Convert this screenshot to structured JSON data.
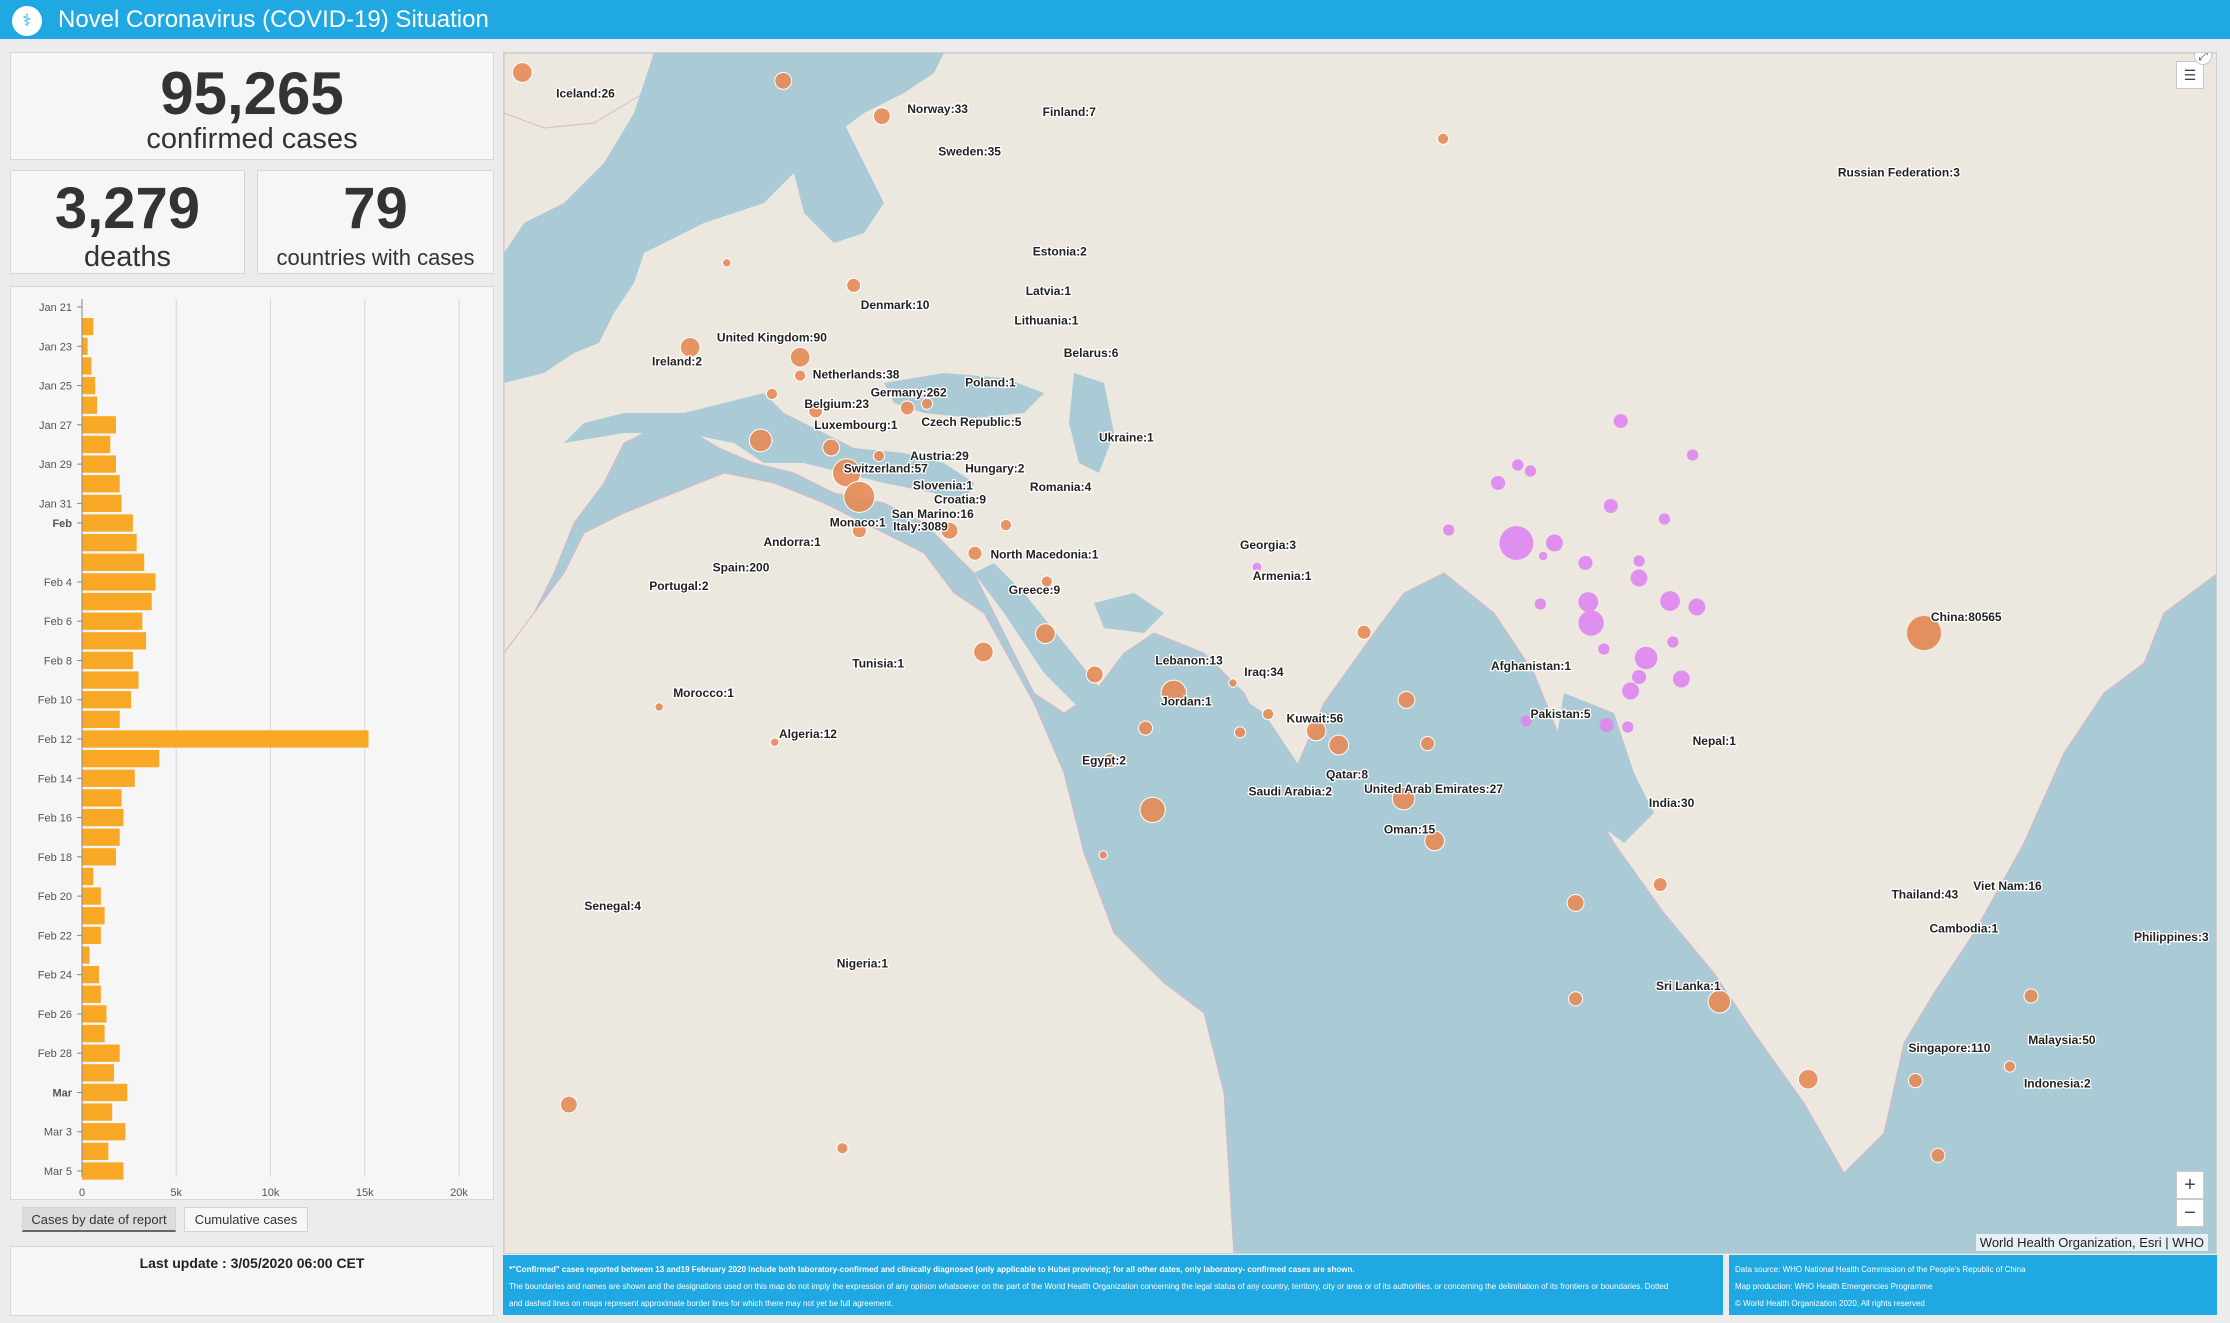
{
  "header": {
    "title": "Novel Coronavirus (COVID-19) Situation",
    "logo_icon": "who-emblem-icon"
  },
  "stats": {
    "confirmed_value": "95,265",
    "confirmed_label": "confirmed cases",
    "deaths_value": "3,279",
    "deaths_label": "deaths",
    "countries_value": "79",
    "countries_label": "countries with cases"
  },
  "chart_data": {
    "type": "bar",
    "orientation": "horizontal",
    "title": "",
    "xlabel": "",
    "ylabel": "",
    "xlim": [
      0,
      20000
    ],
    "x_ticks": [
      "0",
      "5k",
      "10k",
      "15k",
      "20k"
    ],
    "y_tick_labels": [
      "Jan 21",
      "Jan 23",
      "Jan 25",
      "Jan 27",
      "Jan 29",
      "Jan 31",
      "Feb",
      "Feb 4",
      "Feb 6",
      "Feb 8",
      "Feb 10",
      "Feb 12",
      "Feb 14",
      "Feb 16",
      "Feb 18",
      "Feb 20",
      "Feb 22",
      "Feb 24",
      "Feb 26",
      "Feb 28",
      "Mar",
      "Mar 3",
      "Mar 5"
    ],
    "bold_ticks": [
      "Feb",
      "Mar"
    ],
    "categories": [
      "Jan 21",
      "Jan 22",
      "Jan 23",
      "Jan 24",
      "Jan 25",
      "Jan 26",
      "Jan 27",
      "Jan 28",
      "Jan 29",
      "Jan 30",
      "Jan 31",
      "Feb 1",
      "Feb 2",
      "Feb 3",
      "Feb 4",
      "Feb 5",
      "Feb 6",
      "Feb 7",
      "Feb 8",
      "Feb 9",
      "Feb 10",
      "Feb 11",
      "Feb 12",
      "Feb 13",
      "Feb 14",
      "Feb 15",
      "Feb 16",
      "Feb 17",
      "Feb 18",
      "Feb 19",
      "Feb 20",
      "Feb 21",
      "Feb 22",
      "Feb 23",
      "Feb 24",
      "Feb 25",
      "Feb 26",
      "Feb 27",
      "Feb 28",
      "Feb 29",
      "Mar 1",
      "Mar 2",
      "Mar 3",
      "Mar 4",
      "Mar 5"
    ],
    "values": [
      0,
      600,
      300,
      500,
      700,
      800,
      1800,
      1500,
      1800,
      2000,
      2100,
      2700,
      2900,
      3300,
      3900,
      3700,
      3200,
      3400,
      2700,
      3000,
      2600,
      2000,
      15200,
      4100,
      2800,
      2100,
      2200,
      2000,
      1800,
      600,
      1000,
      1200,
      1000,
      400,
      900,
      1000,
      1300,
      1200,
      2000,
      1700,
      2400,
      1600,
      2300,
      1400,
      2200
    ],
    "color": "#f9a825",
    "grid": true
  },
  "tabs": [
    "Cases by date of report",
    "Cumulative cases"
  ],
  "last_update": "Last update : 3/05/2020 06:00 CET",
  "map": {
    "china_color": "#dd86f0",
    "country_color": "#e48b56",
    "labels": [
      {
        "text": "Iceland:26",
        "x": 37,
        "y": 26
      },
      {
        "text": "Norway:33",
        "x": 286,
        "y": 37
      },
      {
        "text": "Finland:7",
        "x": 382,
        "y": 39
      },
      {
        "text": "Sweden:35",
        "x": 308,
        "y": 67
      },
      {
        "text": "Russian Federation:3",
        "x": 946,
        "y": 82
      },
      {
        "text": "Estonia:2",
        "x": 375,
        "y": 138
      },
      {
        "text": "Latvia:1",
        "x": 370,
        "y": 166
      },
      {
        "text": "Denmark:10",
        "x": 253,
        "y": 176
      },
      {
        "text": "Lithuania:1",
        "x": 362,
        "y": 187
      },
      {
        "text": "United Kingdom:90",
        "x": 151,
        "y": 199
      },
      {
        "text": "Belarus:6",
        "x": 397,
        "y": 210
      },
      {
        "text": "Ireland:2",
        "x": 105,
        "y": 216
      },
      {
        "text": "Netherlands:38",
        "x": 219,
        "y": 225
      },
      {
        "text": "Poland:1",
        "x": 327,
        "y": 231
      },
      {
        "text": "Germany:262",
        "x": 260,
        "y": 238
      },
      {
        "text": "Belgium:23",
        "x": 213,
        "y": 246
      },
      {
        "text": "Luxembourg:1",
        "x": 220,
        "y": 261
      },
      {
        "text": "Czech Republic:5",
        "x": 296,
        "y": 259
      },
      {
        "text": "Ukraine:1",
        "x": 422,
        "y": 270
      },
      {
        "text": "Austria:29",
        "x": 288,
        "y": 283
      },
      {
        "text": "Switzerland:57",
        "x": 241,
        "y": 292
      },
      {
        "text": "Hungary:2",
        "x": 327,
        "y": 292
      },
      {
        "text": "Slovenia:1",
        "x": 290,
        "y": 304
      },
      {
        "text": "Romania:4",
        "x": 373,
        "y": 305
      },
      {
        "text": "Croatia:9",
        "x": 305,
        "y": 314
      },
      {
        "text": "San Marino:16",
        "x": 275,
        "y": 324
      },
      {
        "text": "Monaco:1",
        "x": 231,
        "y": 330
      },
      {
        "text": "Italy:3089",
        "x": 276,
        "y": 333
      },
      {
        "text": "Andorra:1",
        "x": 184,
        "y": 344
      },
      {
        "text": "Georgia:3",
        "x": 522,
        "y": 346
      },
      {
        "text": "North Macedonia:1",
        "x": 345,
        "y": 353
      },
      {
        "text": "Spain:200",
        "x": 148,
        "y": 362
      },
      {
        "text": "Armenia:1",
        "x": 531,
        "y": 368
      },
      {
        "text": "Portugal:2",
        "x": 103,
        "y": 375
      },
      {
        "text": "Greece:9",
        "x": 358,
        "y": 378
      },
      {
        "text": "Lebanon:13",
        "x": 462,
        "y": 428
      },
      {
        "text": "Tunisia:1",
        "x": 247,
        "y": 430
      },
      {
        "text": "Iraq:34",
        "x": 525,
        "y": 436
      },
      {
        "text": "Afghanistan:1",
        "x": 700,
        "y": 432
      },
      {
        "text": "China:80565",
        "x": 1012,
        "y": 397
      },
      {
        "text": "Morocco:1",
        "x": 120,
        "y": 451
      },
      {
        "text": "Jordan:1",
        "x": 466,
        "y": 457
      },
      {
        "text": "Pakistan:5",
        "x": 728,
        "y": 466
      },
      {
        "text": "Kuwait:56",
        "x": 555,
        "y": 469
      },
      {
        "text": "Algeria:12",
        "x": 195,
        "y": 480
      },
      {
        "text": "Nepal:1",
        "x": 843,
        "y": 485
      },
      {
        "text": "Egypt:2",
        "x": 410,
        "y": 499
      },
      {
        "text": "Qatar:8",
        "x": 583,
        "y": 509
      },
      {
        "text": "United Arab Emirates:27",
        "x": 610,
        "y": 519
      },
      {
        "text": "Saudi Arabia:2",
        "x": 528,
        "y": 521
      },
      {
        "text": "India:30",
        "x": 812,
        "y": 529
      },
      {
        "text": "Oman:15",
        "x": 624,
        "y": 548
      },
      {
        "text": "Senegal:4",
        "x": 57,
        "y": 602
      },
      {
        "text": "Thailand:43",
        "x": 984,
        "y": 594
      },
      {
        "text": "Viet Nam:16",
        "x": 1042,
        "y": 588
      },
      {
        "text": "Cambodia:1",
        "x": 1011,
        "y": 618
      },
      {
        "text": "Philippines:3",
        "x": 1156,
        "y": 624
      },
      {
        "text": "Nigeria:1",
        "x": 236,
        "y": 643
      },
      {
        "text": "Sri Lanka:1",
        "x": 817,
        "y": 659
      },
      {
        "text": "Malaysia:50",
        "x": 1081,
        "y": 697
      },
      {
        "text": "Singapore:110",
        "x": 996,
        "y": 703
      },
      {
        "text": "Indonesia:2",
        "x": 1078,
        "y": 728
      }
    ]
  },
  "footer": {
    "left_line1": "*\"Confirmed\" cases reported between 13 and19 February 2020 include both laboratory-confirmed and clinically diagnosed (only  applicable to Hubei province); for all other dates, only laboratory-  confirmed cases are shown.",
    "left_line2": "The boundaries and names are shown and the designations used on this map do not imply the expression of any opinion whatsoever on the part of the World Health Organization concerning the legal status of any country, territory, city or area or of its authorities, or concerning the delimitation of its frontiers or boundaries. Dotted",
    "left_line3": "and dashed lines on maps represent approximate border lines for which there may not yet be full agreement.",
    "right_line1": "Data source: WHO National Health Commission of the People's Republic of China",
    "right_line2": "Map production: WHO Health Emergencies Programme",
    "right_line3": "© World Health Organization 2020, All rights reserved"
  },
  "attribution": "World Health Organization, Esri | WHO",
  "controls": {
    "zoom_in": "+",
    "zoom_out": "−",
    "legend_icon": "list-icon"
  }
}
